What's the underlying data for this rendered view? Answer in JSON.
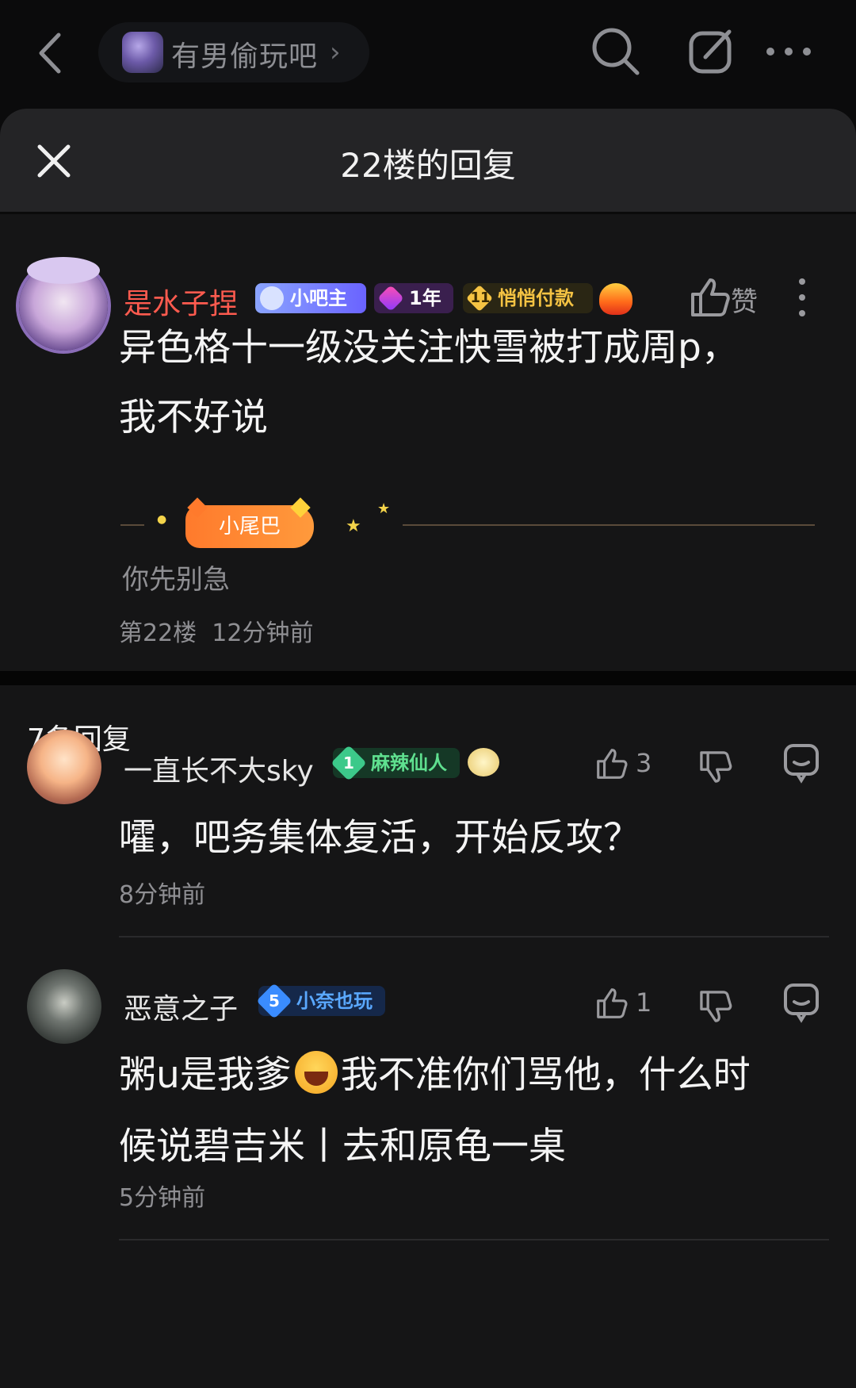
{
  "topbar": {
    "forum_name": "有男偷玩吧",
    "forum_arrow": "›"
  },
  "sheet": {
    "title": "22楼的回复"
  },
  "main_post": {
    "username": "是水子捏",
    "badges": [
      {
        "label": "小吧主"
      },
      {
        "label": "1年"
      },
      {
        "level": "11",
        "label": "悄悄付款"
      }
    ],
    "like_label": "赞",
    "content_lines": [
      "异色格十一级没关注快雪被打成周p，",
      "我不好说"
    ],
    "tail_chip": "小尾巴",
    "tail_text": "你先别急",
    "floor": "第22楼",
    "time": "12分钟前"
  },
  "replies_header": {
    "count_label": "7条回复"
  },
  "replies": [
    {
      "username": "一直长不大sky",
      "level": "1",
      "badge_label": "麻辣仙人",
      "likes": "3",
      "content_lines": [
        "嚯，吧务集体复活，开始反攻？"
      ],
      "time": "8分钟前"
    },
    {
      "username": "恶意之子",
      "level": "5",
      "badge_label": "小奈也玩",
      "likes": "1",
      "content_part1": "粥u是我爹",
      "content_part2": "我不准你们骂他，什么时",
      "content_line2": "候说碧吉米丨去和原龟一桌",
      "time": "5分钟前"
    }
  ],
  "colors": {
    "background": "#0b0b0c",
    "sheet": "#151516",
    "sheet_header": "#242426",
    "username_red": "#ff5b4f",
    "muted": "#8f8f93"
  }
}
